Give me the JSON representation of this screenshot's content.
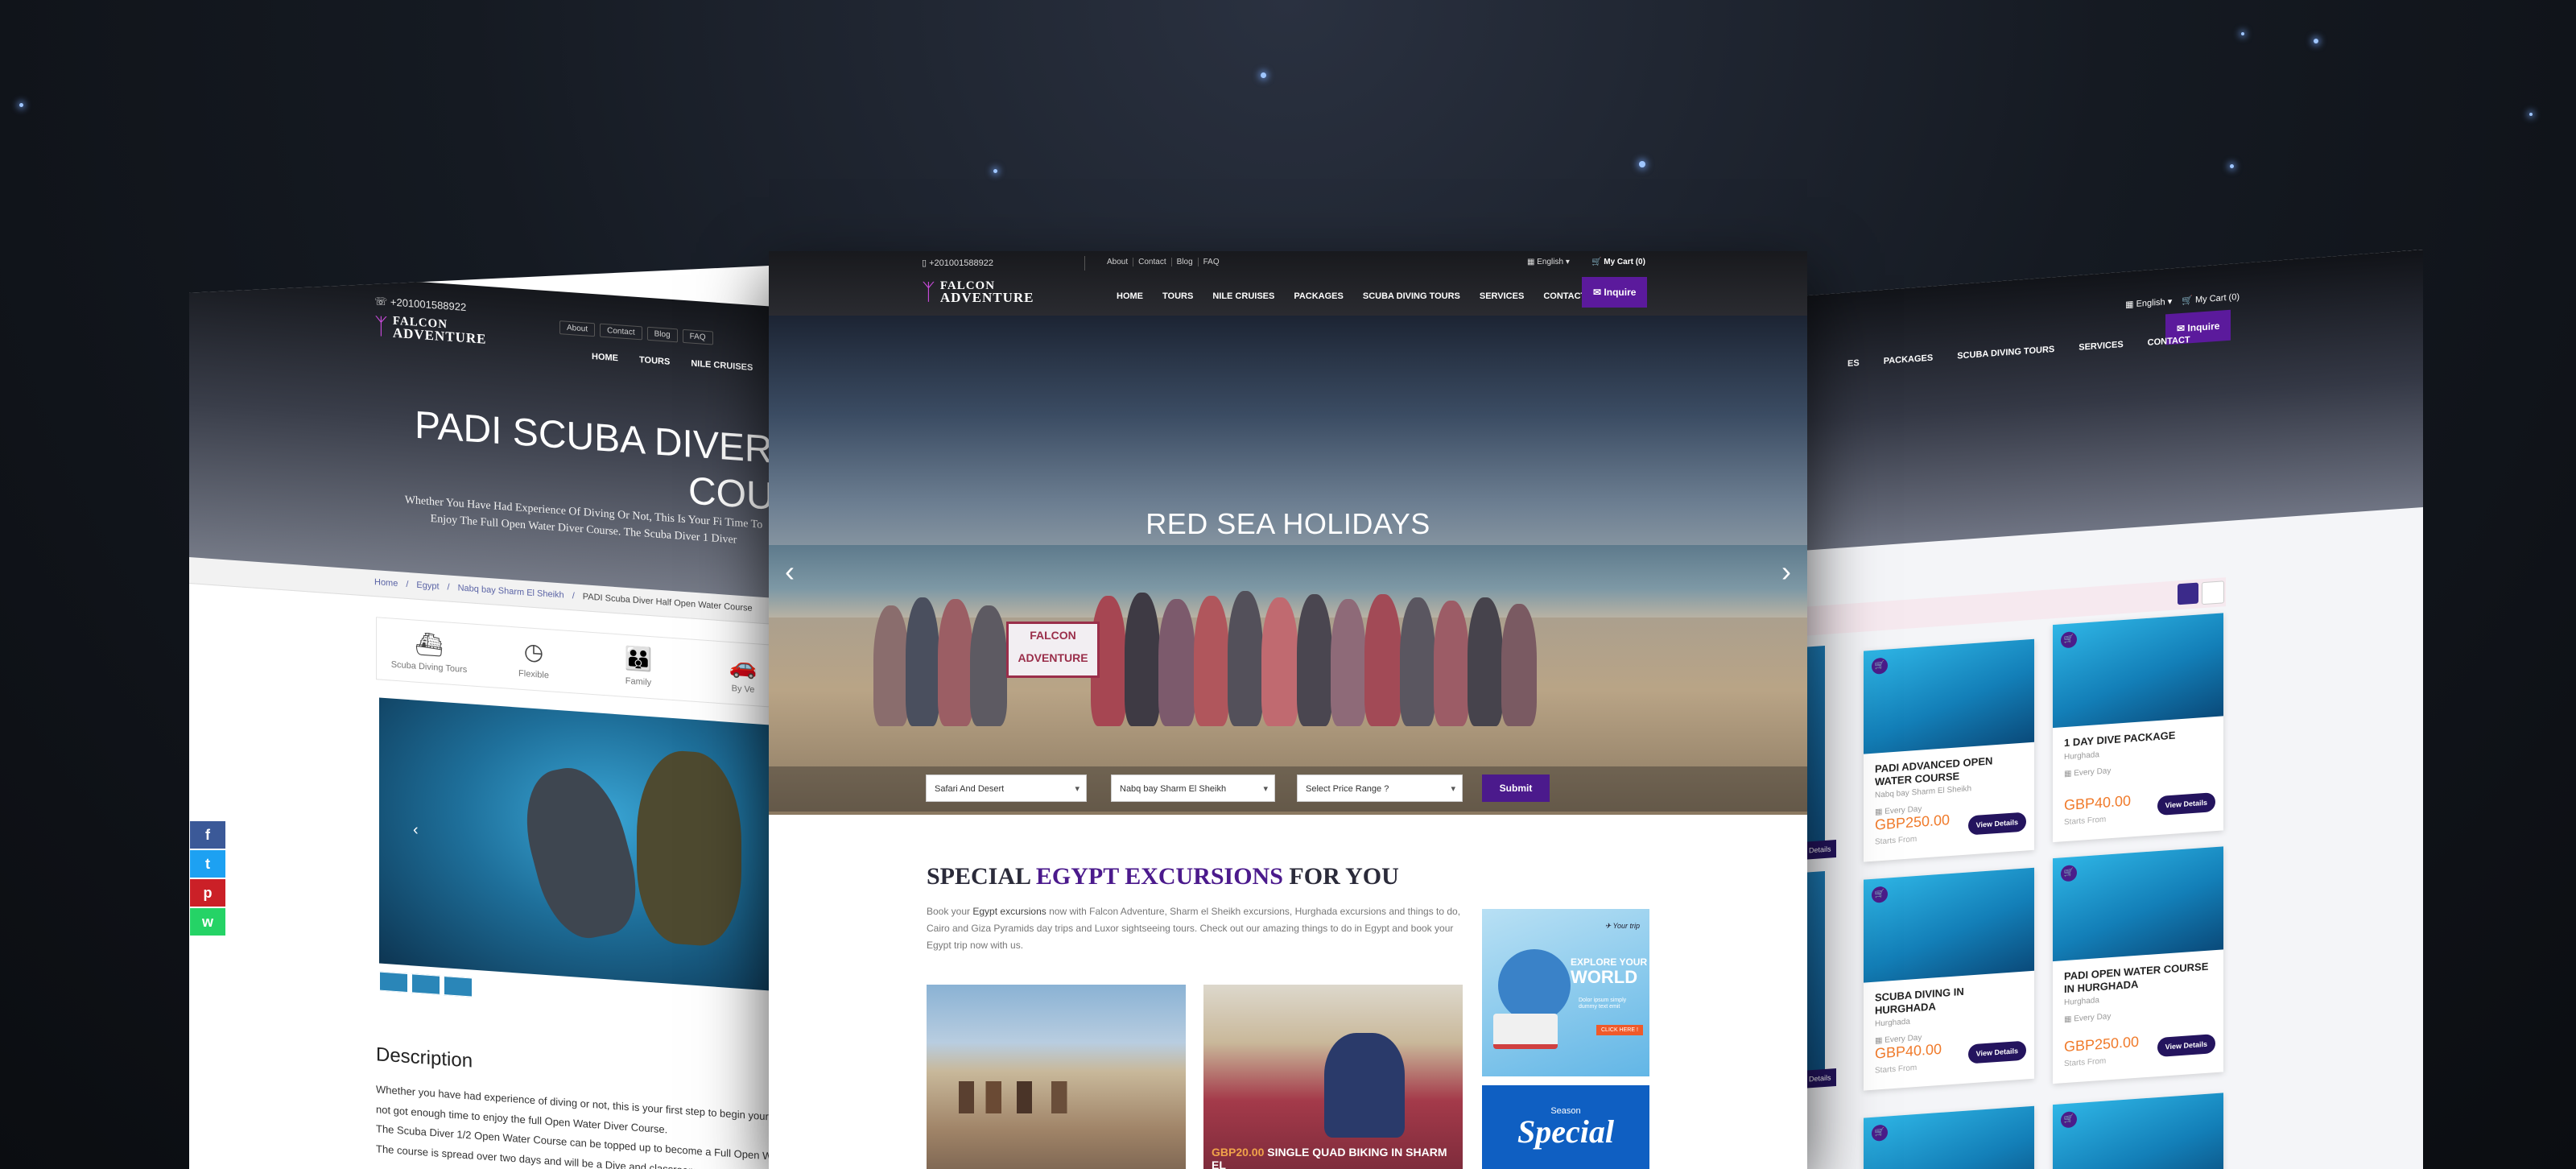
{
  "brand": {
    "line1": "FALCON",
    "line2": "ADVENTURE",
    "accent": "#4b1a8c"
  },
  "left": {
    "phone": "+201001588922",
    "links": [
      "About",
      "Contact",
      "Blog",
      "FAQ"
    ],
    "nav": [
      "HOME",
      "TOURS",
      "NILE CRUISES"
    ],
    "title_line1": "PADI SCUBA DIVER",
    "title_line2": "COU",
    "subtitle": "Whether You Have Had Experience Of Diving Or Not, This Is Your Fi Time To Enjoy The Full Open Water Diver Course. The Scuba Diver 1 Diver",
    "breadcrumb": [
      "Home",
      "Egypt",
      "Nabq bay Sharm El Sheikh",
      "PADI Scuba Diver Half Open Water Course"
    ],
    "features": [
      {
        "icon": "ship-icon",
        "label": "Scuba Diving Tours"
      },
      {
        "icon": "clock-icon",
        "label": "Flexible"
      },
      {
        "icon": "family-icon",
        "label": "Family"
      },
      {
        "icon": "car-icon",
        "label": "By Ve"
      }
    ],
    "description_title": "Description",
    "description": [
      "Whether you have had experience of diving or not, this is your first step to begin your have not got enough time to enjoy the full Open Water Diver Course.",
      "The Scuba Diver 1/2 Open Water Course can be topped up to become a Full Open W",
      "The course is spread over two days and will be a Dive and classroom course include"
    ],
    "social": [
      {
        "icon": "facebook-icon",
        "glyph": "f",
        "color": "#3b5998"
      },
      {
        "icon": "twitter-icon",
        "glyph": "t",
        "color": "#1da1f2"
      },
      {
        "icon": "pinterest-icon",
        "glyph": "p",
        "color": "#cb2027"
      },
      {
        "icon": "whatsapp-icon",
        "glyph": "w",
        "color": "#25d366"
      }
    ]
  },
  "center": {
    "phone": "+201001588922",
    "links": [
      "About",
      "Contact",
      "Blog",
      "FAQ"
    ],
    "language": "English",
    "cart": "My Cart (0)",
    "nav": [
      "HOME",
      "TOURS",
      "NILE CRUISES",
      "PACKAGES",
      "SCUBA DIVING TOURS",
      "SERVICES",
      "CONTACT"
    ],
    "inquire": "Inquire",
    "hero_title": "RED SEA HOLIDAYS",
    "hero_banner": "FALCON ADVENTURE",
    "filters": {
      "type": "Safari And Desert",
      "location": "Nabq bay Sharm El Sheikh",
      "price": "Select Price Range ?",
      "submit": "Submit"
    },
    "section_title_pre": "SPECIAL ",
    "section_title_accent": "EGYPT EXCURSIONS",
    "section_title_post": " FOR YOU",
    "intro_pre": "Book your ",
    "intro_bold": "Egypt excursions",
    "intro_post": " now with Falcon Adventure, Sharm el Sheikh excursions, Hurghada excursions and things to do, Cairo and Giza Pyramids day trips and Luxor sightseeing tours. Check out our amazing things to do in Egypt and book your Egypt trip now with us.",
    "excursion2_price": "GBP20.00",
    "excursion2_caption": " SINGLE QUAD BIKING IN SHARM EL",
    "ad1": {
      "tag": "Your trip",
      "line1": "EXPLORE YOUR",
      "line2": "WORLD",
      "small": "Dolor ipsum simply dummy text emit",
      "btn": "CLICK HERE !"
    },
    "ad2": {
      "line1": "Season",
      "line2": "Special"
    }
  },
  "right": {
    "language": "English",
    "cart": "My Cart (0)",
    "nav": [
      "ES",
      "PACKAGES",
      "SCUBA DIVING TOURS",
      "SERVICES",
      "CONTACT"
    ],
    "inquire": "Inquire",
    "cards": [
      {
        "title": "PADI ADVANCED OPEN WATER COURSE",
        "location": "Nabq bay Sharm El Sheikh",
        "period": "Every Day",
        "price": "GBP250.00",
        "starts": "Starts From",
        "btn": "View Details"
      },
      {
        "title": "1 DAY DIVE PACKAGE",
        "location": "Hurghada",
        "period": "Every Day",
        "price": "GBP40.00",
        "starts": "Starts From",
        "btn": "View Details"
      },
      {
        "title": "SCUBA DIVING IN HURGHADA",
        "location": "Hurghada",
        "period": "Every Day",
        "price": "GBP40.00",
        "starts": "Starts From",
        "btn": "View Details"
      },
      {
        "title": "PADI OPEN WATER COURSE IN HURGHADA",
        "location": "Hurghada",
        "period": "Every Day",
        "price": "GBP250.00",
        "starts": "Starts From",
        "btn": "View Details"
      }
    ],
    "partial_details": [
      "Details",
      "Details"
    ]
  }
}
